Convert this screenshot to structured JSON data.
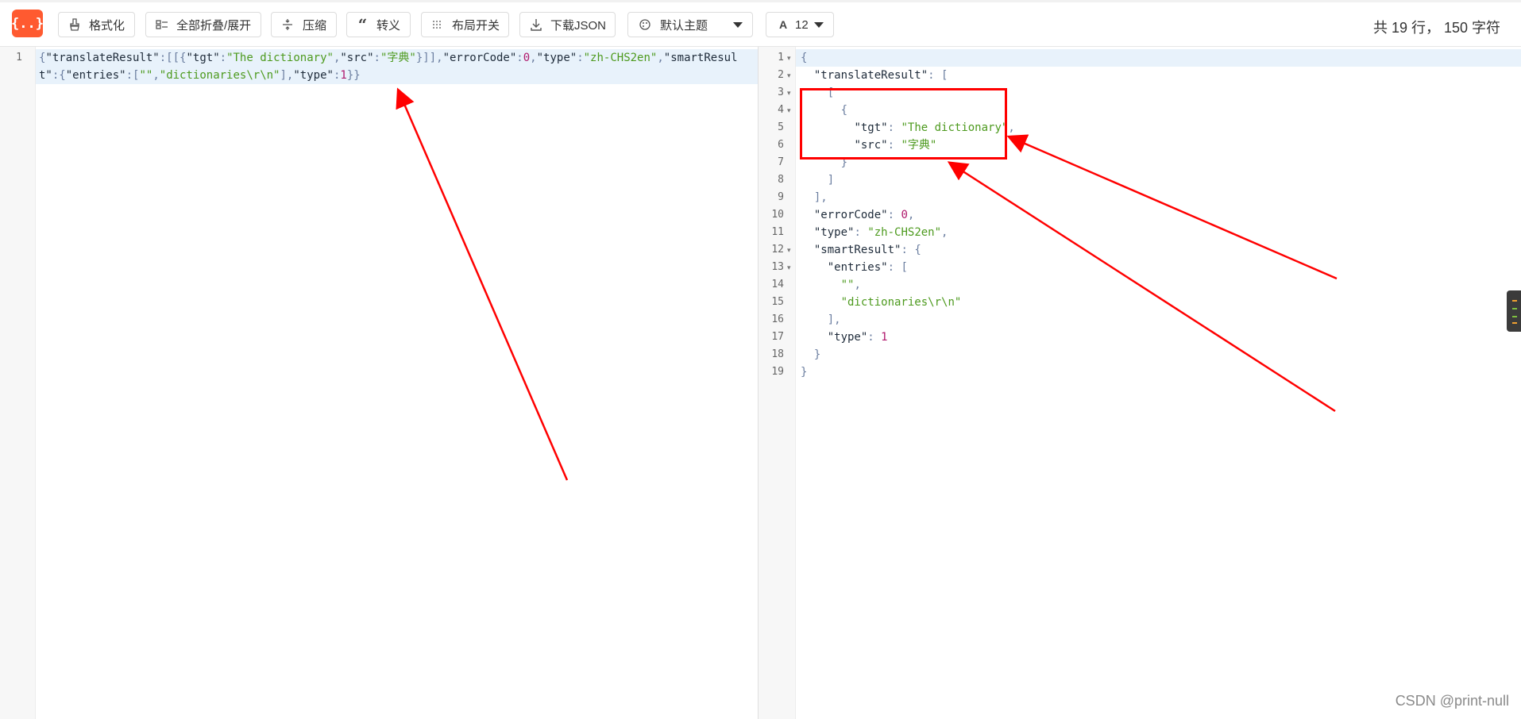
{
  "toolbar": {
    "logo_text": "{..}",
    "buttons": [
      {
        "label": "格式化",
        "icon": "brush-icon"
      },
      {
        "label": "全部折叠/展开",
        "icon": "fold-icon"
      },
      {
        "label": "压缩",
        "icon": "compress-icon"
      },
      {
        "label": "转义",
        "icon": "quote-icon"
      },
      {
        "label": "布局开关",
        "icon": "layout-icon"
      },
      {
        "label": "下载JSON",
        "icon": "download-icon"
      }
    ],
    "theme_select": {
      "label": "默认主题",
      "icon": "theme-icon"
    },
    "font_select": {
      "label": "12",
      "icon": "font-size-icon"
    },
    "stats": "共 19 行， 150 字符"
  },
  "left_editor": {
    "line_number": "1",
    "raw_json": "{\"translateResult\":[[{\"tgt\":\"The dictionary\",\"src\":\"字典\"}]],\"errorCode\":0,\"type\":\"zh-CHS2en\",\"smartResult\":{\"entries\":[\"\",\"dictionaries\\r\\n\"],\"type\":1}}"
  },
  "right_editor": {
    "line_numbers": [
      "1",
      "2",
      "3",
      "4",
      "5",
      "6",
      "7",
      "8",
      "9",
      "10",
      "11",
      "12",
      "13",
      "14",
      "15",
      "16",
      "17",
      "18",
      "19"
    ],
    "lines": [
      "{",
      "  \"translateResult\": [",
      "    [",
      "      {",
      "        \"tgt\": \"The dictionary\",",
      "        \"src\": \"字典\"",
      "      }",
      "    ]",
      "  ],",
      "  \"errorCode\": 0,",
      "  \"type\": \"zh-CHS2en\",",
      "  \"smartResult\": {",
      "    \"entries\": [",
      "      \"\",",
      "      \"dictionaries\\r\\n\"",
      "    ],",
      "    \"type\": 1",
      "  }",
      "}"
    ]
  },
  "colors": {
    "accent": "#ff5a30",
    "string": "#4d9a1e",
    "number": "#b0186c",
    "annotation": "#ff0000"
  },
  "watermark": "CSDN @print-null"
}
